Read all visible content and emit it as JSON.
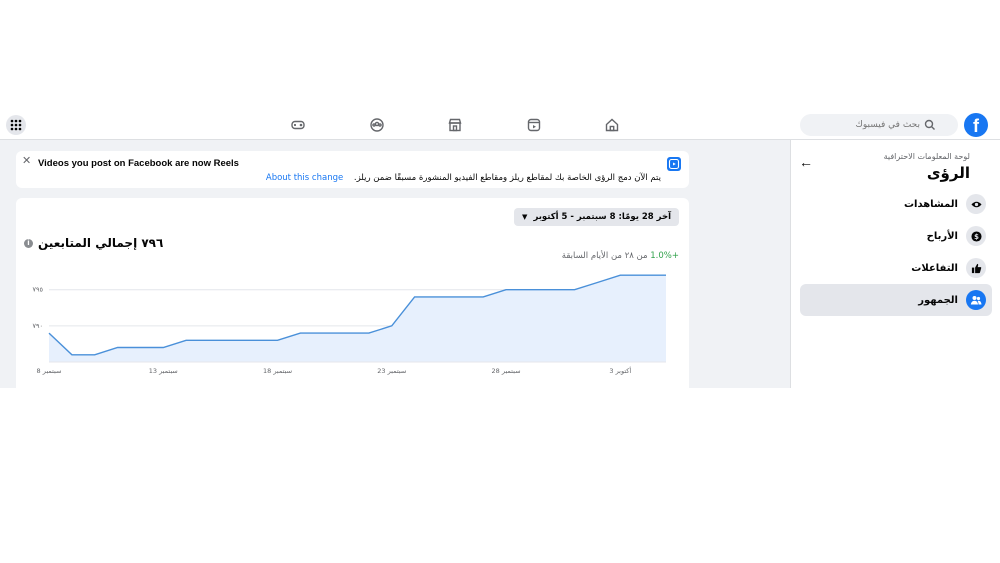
{
  "topbar": {
    "logo_letter": "f",
    "search_placeholder": "بحث في فيسبوك",
    "nav_icons": [
      "home-icon",
      "reels-icon",
      "marketplace-icon",
      "groups-icon",
      "gaming-icon"
    ],
    "menu_icon": "grid-menu-icon"
  },
  "sidebar": {
    "breadcrumb": "لوحة المعلومات الاحترافية",
    "title": "الرؤى",
    "items": [
      {
        "label": "المشاهدات",
        "icon": "eye-icon",
        "active": false
      },
      {
        "label": "الأرباح",
        "icon": "dollar-icon",
        "active": false
      },
      {
        "label": "التفاعلات",
        "icon": "thumbs-up-icon",
        "active": false
      },
      {
        "label": "الجمهور",
        "icon": "people-icon",
        "active": true
      }
    ]
  },
  "notice": {
    "title": "Videos you post on Facebook are now Reels",
    "body": "يتم الآن دمج الرؤى الخاصة بك لمقاطع ريلز ومقاطع الفيديو المنشورة مسبقًا ضمن ريلز.",
    "link": "About this change"
  },
  "card": {
    "date_range": "آخر 28 يومًا: 8 سبتمبر - 5 أكتوبر",
    "followers_total": "٧٩٦ إجمالي المتابعين",
    "change_value": "+1.0%",
    "change_text": "من ٢٨ من الأيام السابقة"
  },
  "colors": {
    "accent": "#1877f2",
    "line": "#4a90d9",
    "fill": "#e7f0fd",
    "positive": "#31a24c"
  },
  "chart_data": {
    "type": "area",
    "x": [
      "8 سبتمبر",
      "9",
      "10",
      "11",
      "12",
      "13",
      "14",
      "15",
      "16",
      "17",
      "18",
      "19",
      "20",
      "21",
      "22",
      "23",
      "24",
      "25",
      "26",
      "27",
      "28",
      "29",
      "30",
      "1",
      "2",
      "3 أكتوبر",
      "4",
      "5"
    ],
    "series": [
      {
        "values": [
          789,
          786,
          786,
          787,
          787,
          787,
          788,
          788,
          788,
          788,
          788,
          789,
          789,
          789,
          789,
          790,
          794,
          794,
          794,
          794,
          795,
          795,
          795,
          795,
          796,
          797,
          797,
          797
        ]
      }
    ],
    "y_ticks": [
      "٧٩٠",
      "٧٩٥"
    ],
    "y_tick_values": [
      790,
      795
    ],
    "x_ticks": [
      "8 سبتمبر",
      "13 سبتمبر",
      "18 سبتمبر",
      "23 سبتمبر",
      "28 سبتمبر",
      "3 أكتوبر"
    ],
    "x_tick_index": [
      0,
      5,
      10,
      15,
      20,
      25
    ],
    "ylim": [
      785,
      798
    ],
    "grid": true
  }
}
